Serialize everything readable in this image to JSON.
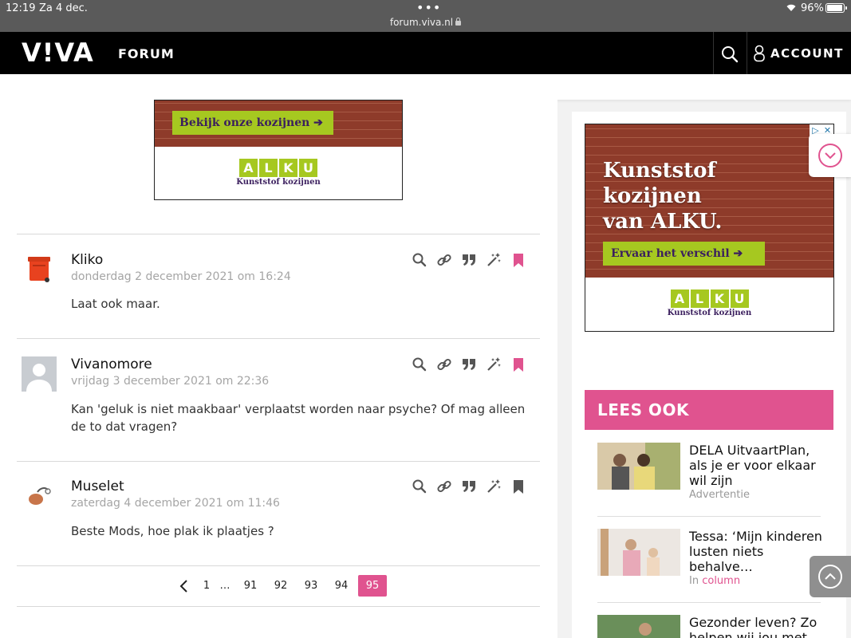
{
  "status": {
    "time": "12:19",
    "date": "Za 4 dec.",
    "url": "forum.viva.nl",
    "battery": "96%"
  },
  "nav": {
    "logo": "V!VA",
    "forum": "FORUM",
    "account": "ACCOUNT"
  },
  "ads": {
    "top": {
      "cta": "Bekijk onze kozijnen ➔",
      "brand": [
        "A",
        "L",
        "K",
        "U"
      ],
      "sub": "Kunststof kozijnen"
    },
    "side": {
      "headline": [
        "Kunststof",
        "kozijnen",
        "van ALKU."
      ],
      "cta": "Ervaar het verschil ➔",
      "brand": [
        "A",
        "L",
        "K",
        "U"
      ],
      "sub": "Kunststof kozijnen"
    }
  },
  "posts": [
    {
      "user": "Kliko",
      "date": "donderdag 2 december 2021 om 16:24",
      "body": "Laat ook maar.",
      "bookmarked": true
    },
    {
      "user": "Vivanomore",
      "date": "vrijdag 3 december 2021 om 22:36",
      "body": "Kan 'geluk is niet maakbaar' verplaatst worden naar psyche? Of mag alleen de to dat vragen?",
      "bookmarked": true
    },
    {
      "user": "Muselet",
      "date": "zaterdag 4 december 2021 om 11:46",
      "body": "Beste Mods, hoe plak ik plaatjes ?",
      "bookmarked": false
    }
  ],
  "pagination": {
    "pages": [
      "1",
      "…",
      "91",
      "92",
      "93",
      "94",
      "95"
    ],
    "current": "95"
  },
  "lees_ook": {
    "heading": "LEES OOK",
    "items": [
      {
        "title": "DELA UitvaartPlan, als je er voor elkaar wil zijn",
        "meta": "Advertentie",
        "category": ""
      },
      {
        "title": "Tessa: ‘Mijn kinderen lusten niets behalve…",
        "meta": "In",
        "category": "column"
      },
      {
        "title": "Gezonder leven? Zo helpen wij jou met",
        "meta": "",
        "category": ""
      }
    ]
  },
  "colors": {
    "accent": "#e0538f",
    "nav": "#000000",
    "ad_green": "#a6c820",
    "ad_purple": "#3b1f5e"
  }
}
